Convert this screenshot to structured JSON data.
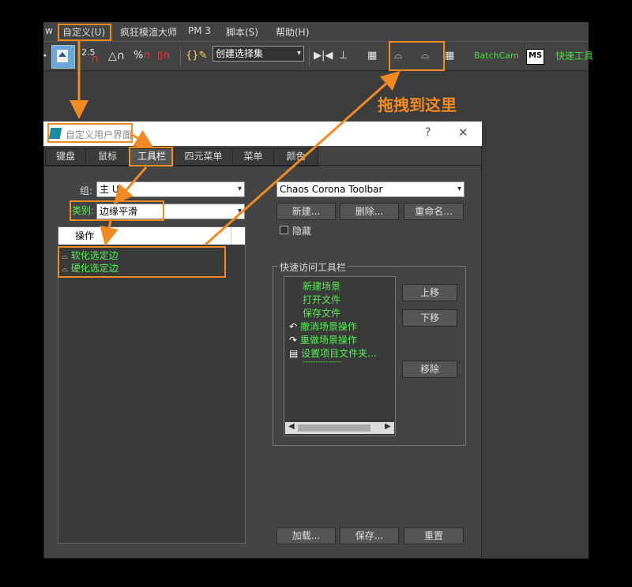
{
  "menubar": {
    "items": [
      "w",
      "自定义(U)",
      "疯狂模渲大师",
      "PM 3",
      "脚本(S)",
      "帮助(H)"
    ]
  },
  "toolbar": {
    "snap_value": "2.5",
    "percent": "%",
    "selection_set_placeholder": "创建选择集",
    "batchcam": "BatchCam",
    "ms": "MS",
    "quick_tools": "快速工具"
  },
  "annotation": {
    "drag_here": "拖拽到这里"
  },
  "dialog": {
    "title": "自定义用户界面",
    "help": "?",
    "close": "✕",
    "tabs": [
      "键盘",
      "鼠标",
      "工具栏",
      "四元菜单",
      "菜单",
      "颜色"
    ],
    "group_label": "组:",
    "group_value": "主 UI",
    "category_label": "类别:",
    "category_value": "边缘平滑",
    "actions_header": "操作",
    "actions": [
      "软化选定边",
      "硬化选定边"
    ],
    "toolbar_select": "Chaos Corona Toolbar",
    "new_btn": "新建...",
    "delete_btn": "删除...",
    "rename_btn": "重命名...",
    "hide_label": "隐藏",
    "quick_access_label": "快速访问工具栏",
    "quick_items": [
      "新建场景",
      "打开文件",
      "保存文件",
      "撤消场景操作",
      "重做场景操作",
      "设置项目文件夹...",
      "---------------"
    ],
    "up_btn": "上移",
    "down_btn": "下移",
    "remove_btn": "移除",
    "load_btn": "加载...",
    "save_btn": "保存...",
    "reset_btn": "重置"
  },
  "colors": {
    "accent": "#f08a24",
    "green_text": "#55ee55"
  }
}
